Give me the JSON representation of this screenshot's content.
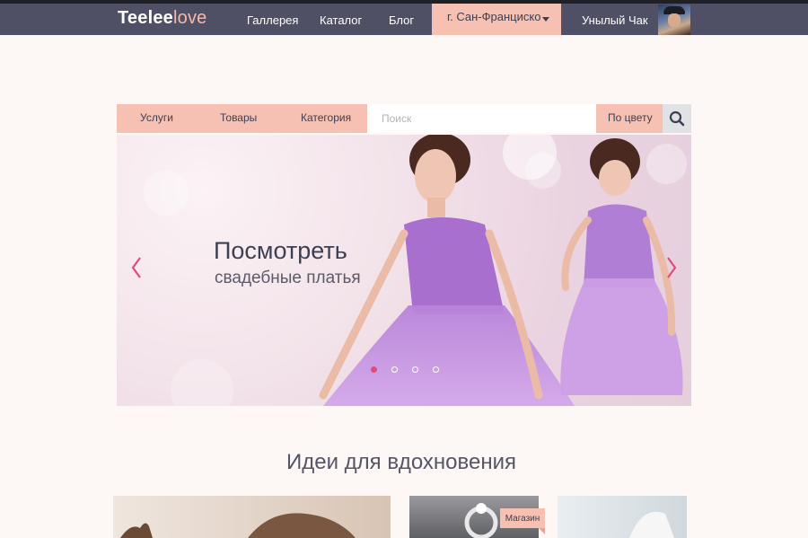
{
  "header": {
    "logo_main": "Teelee",
    "logo_accent": "love",
    "nav": [
      "Галлерея",
      "Каталог",
      "Блог"
    ],
    "city": "г. Сан-Франциско",
    "username": "Унылый Чак"
  },
  "search": {
    "tabs": [
      "Услуги",
      "Товары",
      "Категория"
    ],
    "placeholder": "Поиск",
    "color_filter": "По цвету"
  },
  "hero": {
    "title": "Посмотреть",
    "subtitle": "свадебные платья",
    "slides": 4,
    "active_slide": 1
  },
  "section": {
    "title": "Идеи для вдохновения"
  },
  "cards": {
    "badge": "Магазин"
  },
  "colors": {
    "header_bg": "#4f5065",
    "accent": "#f6c1b2",
    "page_bg": "#fdf7f5",
    "arrow": "#e04c7a"
  }
}
